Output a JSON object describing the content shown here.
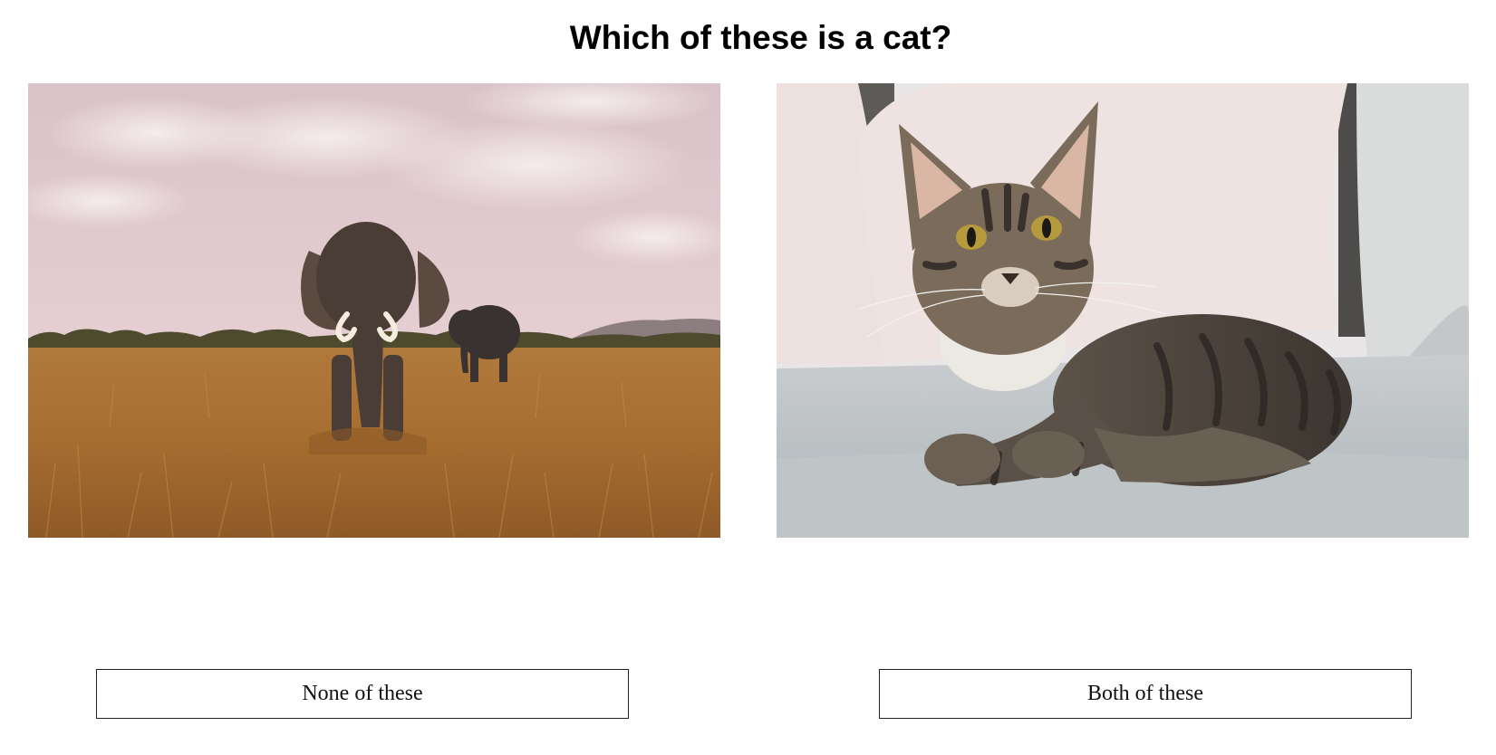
{
  "question": {
    "title": "Which of these is a cat?"
  },
  "images": [
    {
      "subject": "elephants-in-savanna"
    },
    {
      "subject": "tabby-cat-on-sofa"
    }
  ],
  "buttons": {
    "none_label": "None of these",
    "both_label": "Both of these"
  },
  "colors": {
    "background": "#ffffff",
    "text": "#000000",
    "button_border": "#222222"
  }
}
